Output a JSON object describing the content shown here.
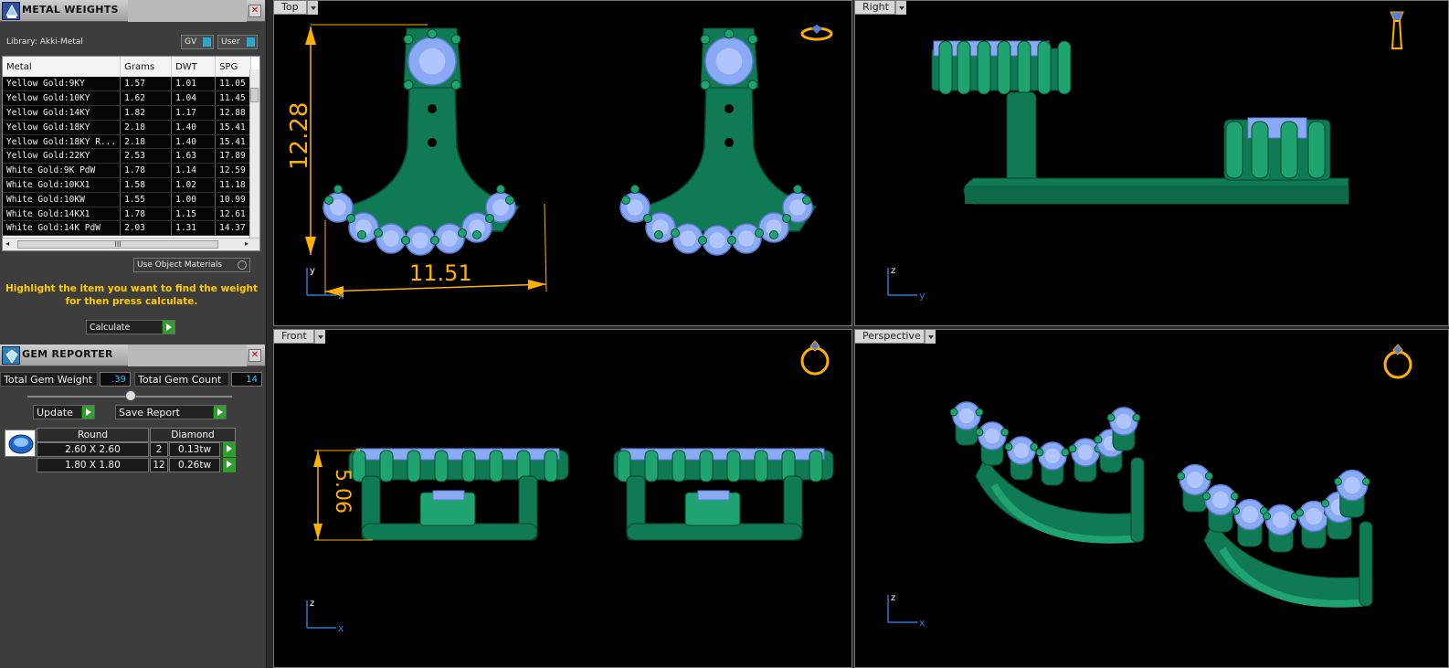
{
  "metal_weights": {
    "title": "METAL WEIGHTS",
    "library_label": "Library: Akki-Metal",
    "gv_button": "GV",
    "user_button": "User",
    "columns": [
      "Metal",
      "Grams",
      "DWT",
      "SPG"
    ],
    "rows": [
      [
        "Yellow Gold:9KY",
        "1.57",
        "1.01",
        "11.05"
      ],
      [
        "Yellow Gold:10KY",
        "1.62",
        "1.04",
        "11.45"
      ],
      [
        "Yellow Gold:14KY",
        "1.82",
        "1.17",
        "12.88"
      ],
      [
        "Yellow Gold:18KY",
        "2.18",
        "1.40",
        "15.41"
      ],
      [
        "Yellow Gold:18KY R...",
        "2.18",
        "1.40",
        "15.41"
      ],
      [
        "Yellow Gold:22KY",
        "2.53",
        "1.63",
        "17.89"
      ],
      [
        "White Gold:9K PdW",
        "1.78",
        "1.14",
        "12.59"
      ],
      [
        "White Gold:10KX1",
        "1.58",
        "1.02",
        "11.18"
      ],
      [
        "White Gold:10KW",
        "1.55",
        "1.00",
        "10.99"
      ],
      [
        "White Gold:14KX1",
        "1.78",
        "1.15",
        "12.61"
      ],
      [
        "White Gold:14K PdW",
        "2.03",
        "1.31",
        "14.37"
      ]
    ],
    "hscroll_grip": "III",
    "use_object_materials": "Use Object Materials",
    "hint": "Highlight the item you want to find the weight for then press calculate.",
    "calculate_button": "Calculate"
  },
  "gem_reporter": {
    "title": "GEM REPORTER",
    "total_weight_label": "Total Gem Weight",
    "total_weight_value": ".39",
    "total_count_label": "Total Gem Count",
    "total_count_value": "14",
    "update_button": "Update",
    "save_report_button": "Save Report",
    "shape_header": "Round",
    "type_header": "Diamond",
    "gems": [
      {
        "size": "2.60 X 2.60",
        "count": "2",
        "weight": "0.13tw"
      },
      {
        "size": "1.80 X 1.80",
        "count": "12",
        "weight": "0.26tw"
      }
    ]
  },
  "viewports": {
    "top": {
      "label": "Top",
      "dim_height": "12.28",
      "dim_width": "11.51",
      "axis_v": "y",
      "axis_h": "x"
    },
    "right": {
      "label": "Right",
      "axis_v": "z",
      "axis_h": "y"
    },
    "front": {
      "label": "Front",
      "dim_height": "5.06",
      "axis_v": "z",
      "axis_h": "x"
    },
    "perspective": {
      "label": "Perspective",
      "axis_v": "z",
      "axis_h": "x",
      "axis_d": "y"
    }
  },
  "colors": {
    "metal": "#0f7a54",
    "metal_light": "#1fa370",
    "gem": "#8aaaf5",
    "dimension": "#ffb000",
    "viewport_bg": "#000000"
  }
}
